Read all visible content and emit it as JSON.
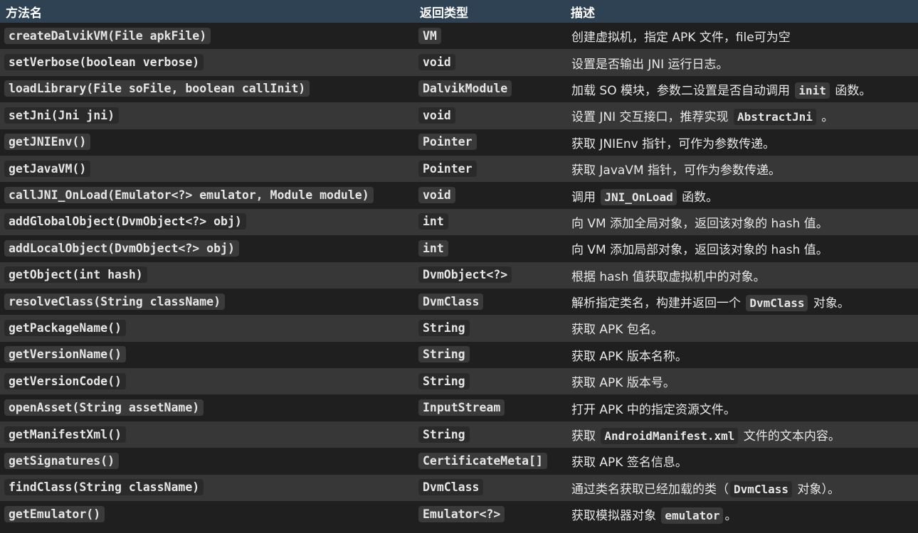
{
  "headers": [
    "方法名",
    "返回类型",
    "描述"
  ],
  "rows": [
    {
      "method": "createDalvikVM(File apkFile)",
      "ret": "VM",
      "desc": [
        "创建虚拟机，指定 APK 文件，file可为空"
      ]
    },
    {
      "method": "setVerbose(boolean verbose)",
      "ret": "void",
      "desc": [
        "设置是否输出 JNI 运行日志。"
      ]
    },
    {
      "method": "loadLibrary(File soFile, boolean callInit)",
      "ret": "DalvikModule",
      "desc": [
        "加载 SO 模块，参数二设置是否自动调用 ",
        "init",
        " 函数。"
      ]
    },
    {
      "method": "setJni(Jni jni)",
      "ret": "void",
      "desc": [
        "设置 JNI 交互接口，推荐实现 ",
        "AbstractJni",
        " 。"
      ]
    },
    {
      "method": "getJNIEnv()",
      "ret": "Pointer",
      "desc": [
        "获取 JNIEnv 指针，可作为参数传递。"
      ]
    },
    {
      "method": "getJavaVM()",
      "ret": "Pointer",
      "desc": [
        "获取 JavaVM 指针，可作为参数传递。"
      ]
    },
    {
      "method": "callJNI_OnLoad(Emulator<?> emulator, Module module)",
      "ret": "void",
      "desc": [
        "调用 ",
        "JNI_OnLoad",
        " 函数。"
      ]
    },
    {
      "method": "addGlobalObject(DvmObject<?> obj)",
      "ret": "int",
      "desc": [
        "向 VM 添加全局对象，返回该对象的 hash 值。"
      ]
    },
    {
      "method": "addLocalObject(DvmObject<?> obj)",
      "ret": "int",
      "desc": [
        "向 VM 添加局部对象，返回该对象的 hash 值。"
      ]
    },
    {
      "method": "getObject(int hash)",
      "ret": "DvmObject<?>",
      "desc": [
        "根据 hash 值获取虚拟机中的对象。"
      ]
    },
    {
      "method": "resolveClass(String className)",
      "ret": "DvmClass",
      "desc": [
        "解析指定类名，构建并返回一个 ",
        "DvmClass",
        " 对象。"
      ]
    },
    {
      "method": "getPackageName()",
      "ret": "String",
      "desc": [
        "获取 APK 包名。"
      ]
    },
    {
      "method": "getVersionName()",
      "ret": "String",
      "desc": [
        "获取 APK 版本名称。"
      ]
    },
    {
      "method": "getVersionCode()",
      "ret": "String",
      "desc": [
        "获取 APK 版本号。"
      ]
    },
    {
      "method": "openAsset(String assetName)",
      "ret": "InputStream",
      "desc": [
        "打开 APK 中的指定资源文件。"
      ]
    },
    {
      "method": "getManifestXml()",
      "ret": "String",
      "desc": [
        "获取 ",
        "AndroidManifest.xml",
        " 文件的文本内容。"
      ]
    },
    {
      "method": "getSignatures()",
      "ret": "CertificateMeta[]",
      "desc": [
        "获取 APK 签名信息。"
      ]
    },
    {
      "method": "findClass(String className)",
      "ret": "DvmClass",
      "desc": [
        "通过类名获取已经加载的类（",
        "DvmClass",
        " 对象）。"
      ]
    },
    {
      "method": "getEmulator()",
      "ret": "Emulator<?>",
      "desc": [
        "获取模拟器对象 ",
        "emulator",
        "。"
      ]
    }
  ]
}
